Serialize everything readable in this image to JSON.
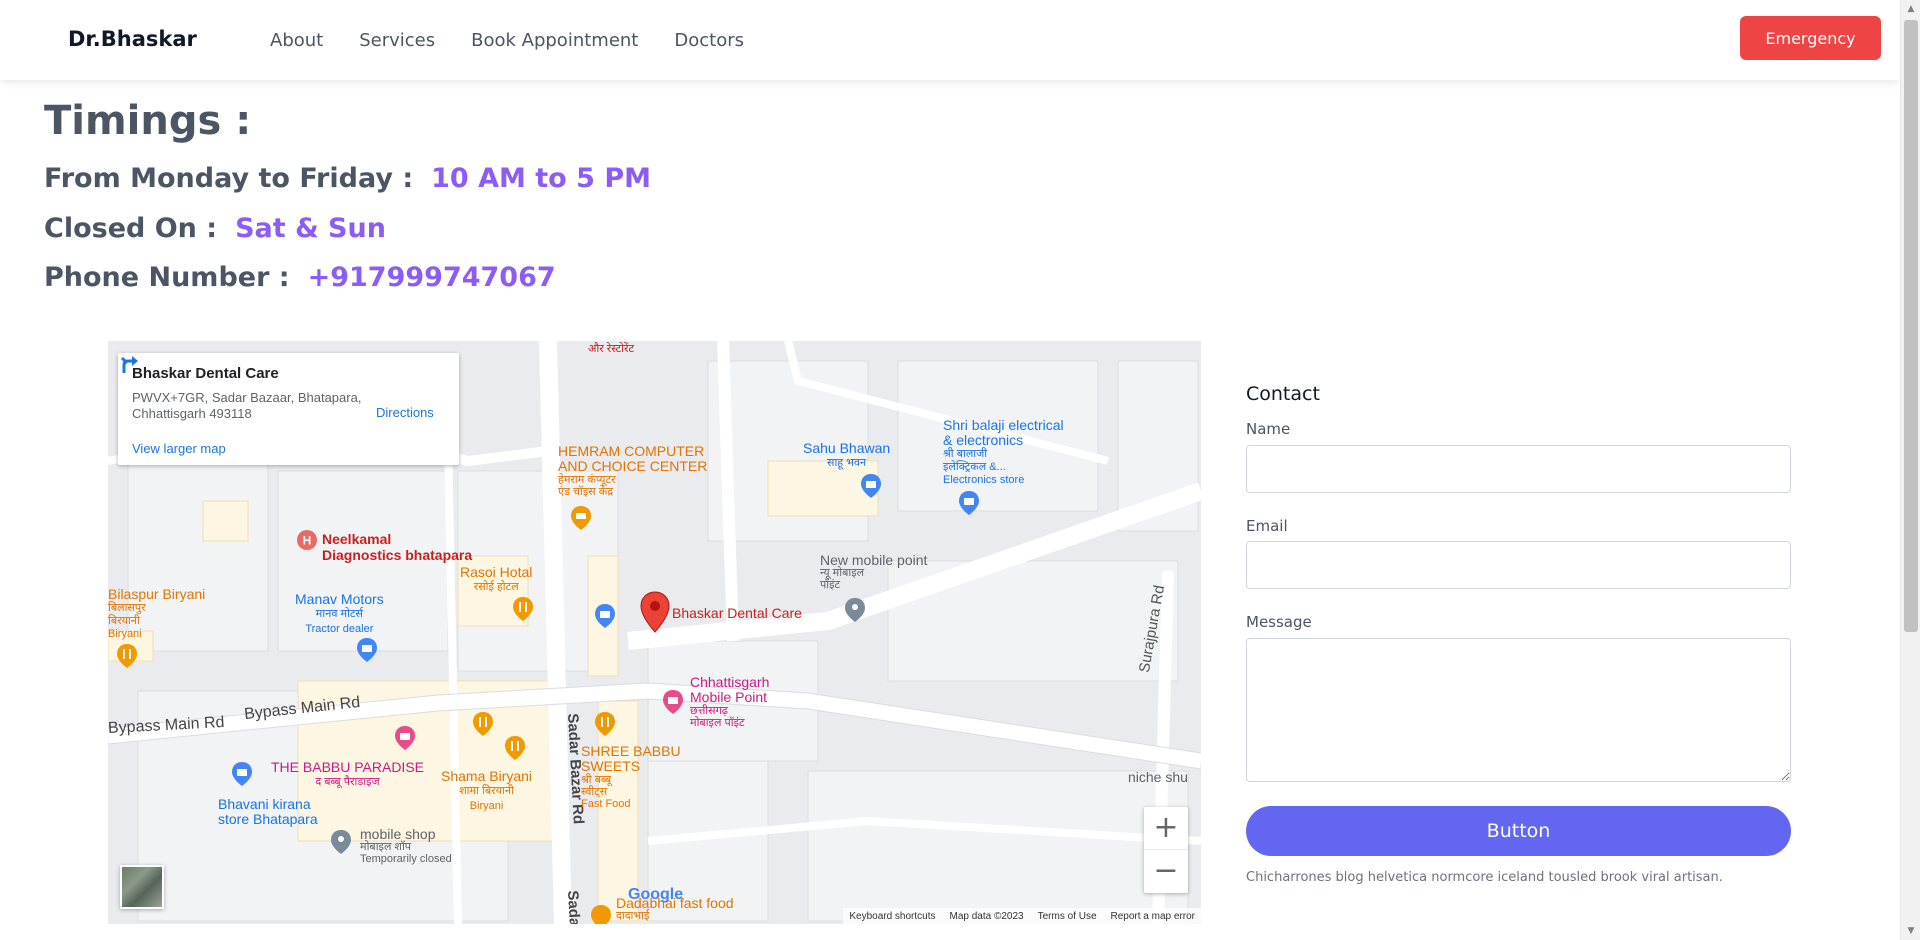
{
  "header": {
    "brand": "Dr.Bhaskar",
    "nav": [
      "About",
      "Services",
      "Book Appointment",
      "Doctors"
    ],
    "emergency_label": "Emergency"
  },
  "timings": {
    "title": "Timings :",
    "weekday_label": "From Monday to Friday :",
    "weekday_value": "10 AM to 5 PM",
    "closed_label": "Closed On :",
    "closed_value": "Sat & Sun",
    "phone_label": "Phone Number :",
    "phone_value": "+917999747067"
  },
  "map": {
    "card_name": "Bhaskar Dental Care",
    "card_address": "PWVX+7GR, Sadar Bazaar, Bhatapara, Chhattisgarh 493118",
    "directions_label": "Directions",
    "larger_map_label": "View larger map",
    "logo": "Google",
    "attribution": [
      "Keyboard shortcuts",
      "Map data ©2023",
      "Terms of Use",
      "Report a map error"
    ],
    "labels": {
      "marker": "Bhaskar Dental Care",
      "hemram1": "HEMRAM COMPUTER",
      "hemram2": "AND CHOICE CENTER",
      "hemram3": "हेमराम कंप्यूटर",
      "hemram4": "एंड चॉइस केंद्र",
      "restaurant_top": "और रेस्टोरेंट",
      "sahu1": "Sahu Bhawan",
      "sahu2": "साहू भवन",
      "balaji1": "Shri balaji electrical",
      "balaji2": "& electronics",
      "balaji3": "श्री बालाजी",
      "balaji4": "इलेक्ट्रिकल &...",
      "balaji5": "Electronics store",
      "neelkamal1": "Neelkamal",
      "neelkamal2": "Diagnostics bhatapara",
      "rasoi1": "Rasoi Hotal",
      "rasoi2": "रसोई होटल",
      "manav1": "Manav Motors",
      "manav2": "मानव मोटर्स",
      "manav3": "Tractor dealer",
      "bilaspur1": "Bilaspur Biryani",
      "bilaspur2": "बिलासपुर",
      "bilaspur3": "बिरयानी",
      "bilaspur4": "Biryani",
      "newmobile1": "New mobile point",
      "newmobile2": "न्यू मोबाइल",
      "newmobile3": "पॉइंट",
      "surajpura": "Surajpura Rd",
      "bypass1": "Bypass Main Rd",
      "bypass2": "Bypass Main Rd",
      "sadar1": "Sadar Bazar Rd",
      "sadar2": "Sadar Rd",
      "chh1": "Chhattisgarh",
      "chh2": "Mobile Point",
      "chh3": "छत्तीसगढ़",
      "chh4": "मोबाइल पॉइंट",
      "babbu1": "THE BABBU PARADISE",
      "babbu2": "द बब्बू पैराडाइज",
      "shama1": "Shama Biryani",
      "shama2": "शामा बिरयानी",
      "shama3": "Biryani",
      "shree1": "SHREE BABBU",
      "shree2": "SWEETS",
      "shree3": "श्री बब्बू",
      "shree4": "स्वीट्स",
      "shree5": "Fast Food",
      "bhavani1": "Bhavani kirana",
      "bhavani2": "store Bhatapara",
      "mobileshop1": "mobile shop",
      "mobileshop2": "मोबाइल शॉप",
      "mobileshop3": "Temporarily closed",
      "niche": "niche shu",
      "dadabhai1": "Dadabhai fast food",
      "dadabhai2": "दादाभाई"
    }
  },
  "contact": {
    "title": "Contact",
    "name_label": "Name",
    "email_label": "Email",
    "message_label": "Message",
    "submit_label": "Button",
    "note": "Chicharrones blog helvetica normcore iceland tousled brook viral artisan."
  },
  "colors": {
    "accent": "#8b5cf6",
    "button": "#6366f1",
    "emergency": "#ef4444",
    "heading": "#4b5563"
  }
}
